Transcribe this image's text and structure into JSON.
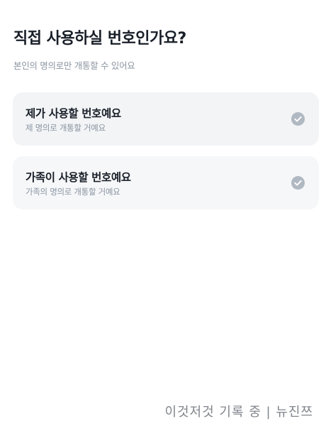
{
  "header": {
    "title": "직접 사용하실 번호인가요?",
    "subtitle": "본인의 명의로만 개통할 수 있어요"
  },
  "options": [
    {
      "title": "제가 사용할 번호예요",
      "description": "제 명의로 개통할 거예요",
      "icon": "check-circle-icon"
    },
    {
      "title": "가족이 사용할 번호예요",
      "description": "가족의 명의로 개통할 거예요",
      "icon": "check-circle-icon"
    }
  ],
  "watermark": "이것저것 기록 중 | 뉴진쯔",
  "colors": {
    "card_background": "#f2f4f6",
    "check_icon": "#b0b8c1",
    "title_text": "#191f28",
    "secondary_text": "#8b95a1"
  }
}
